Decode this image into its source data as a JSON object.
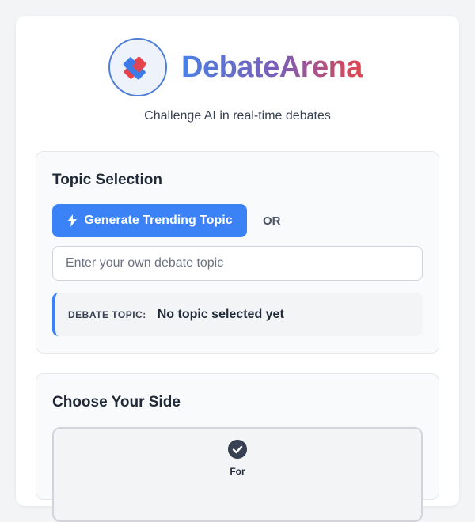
{
  "brand": {
    "name": "DebateArena",
    "tagline": "Challenge AI in real-time debates"
  },
  "topic_section": {
    "title": "Topic Selection",
    "generate_button": "Generate Trending Topic",
    "or_label": "OR",
    "input_placeholder": "Enter your own debate topic",
    "input_value": "",
    "topic_key": "DEBATE TOPIC:",
    "topic_value": "No topic selected yet"
  },
  "side_section": {
    "title": "Choose Your Side",
    "options": [
      {
        "label": "For",
        "selected": true,
        "icon": "check-circle-icon"
      }
    ]
  },
  "colors": {
    "accent": "#3b82f6",
    "brand_gradient": [
      "#4a80e3",
      "#7d5db5",
      "#e0474f"
    ],
    "logo_red": "#e8424a",
    "logo_blue": "#3d7be8"
  }
}
